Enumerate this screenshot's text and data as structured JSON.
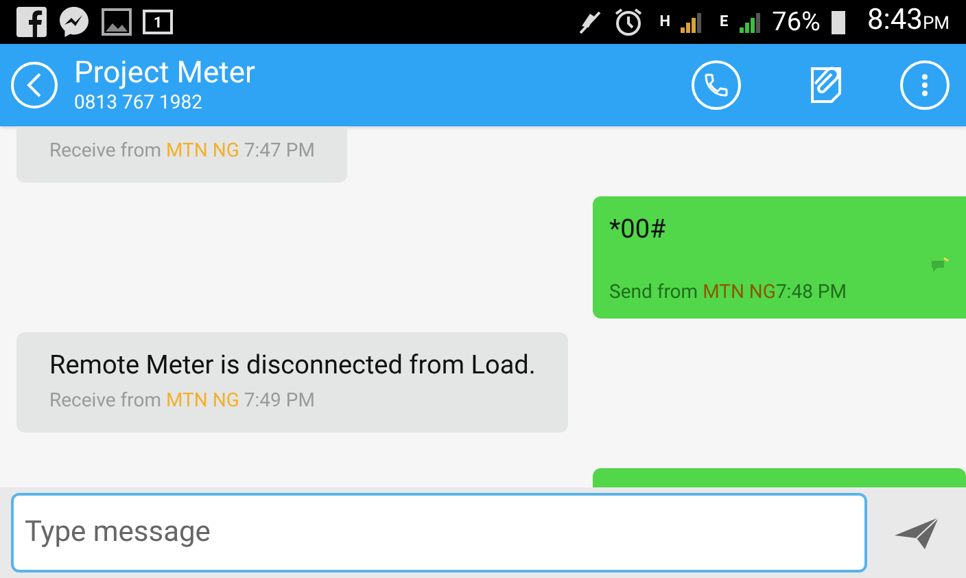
{
  "status_bar": {
    "calendar_day": "1",
    "network_1": "H",
    "network_2": "E",
    "battery": "76%",
    "time": "8:43",
    "time_suffix": "PM"
  },
  "header": {
    "title": "Project Meter",
    "subtitle": "0813 767 1982"
  },
  "messages": [
    {
      "kind": "received_cut",
      "meta_prefix": "Receive from",
      "carrier": "MTN NG",
      "time": "7:47 PM"
    },
    {
      "kind": "sent",
      "text": "*00#",
      "meta_prefix": "Send from",
      "carrier": "MTN NG",
      "time": "7:48 PM"
    },
    {
      "kind": "received",
      "text": "Remote Meter is disconnected from Load.",
      "meta_prefix": "Receive from",
      "carrier": "MTN NG",
      "time": "7:49 PM"
    },
    {
      "kind": "sent_cut"
    }
  ],
  "composer": {
    "placeholder": "Type message"
  }
}
